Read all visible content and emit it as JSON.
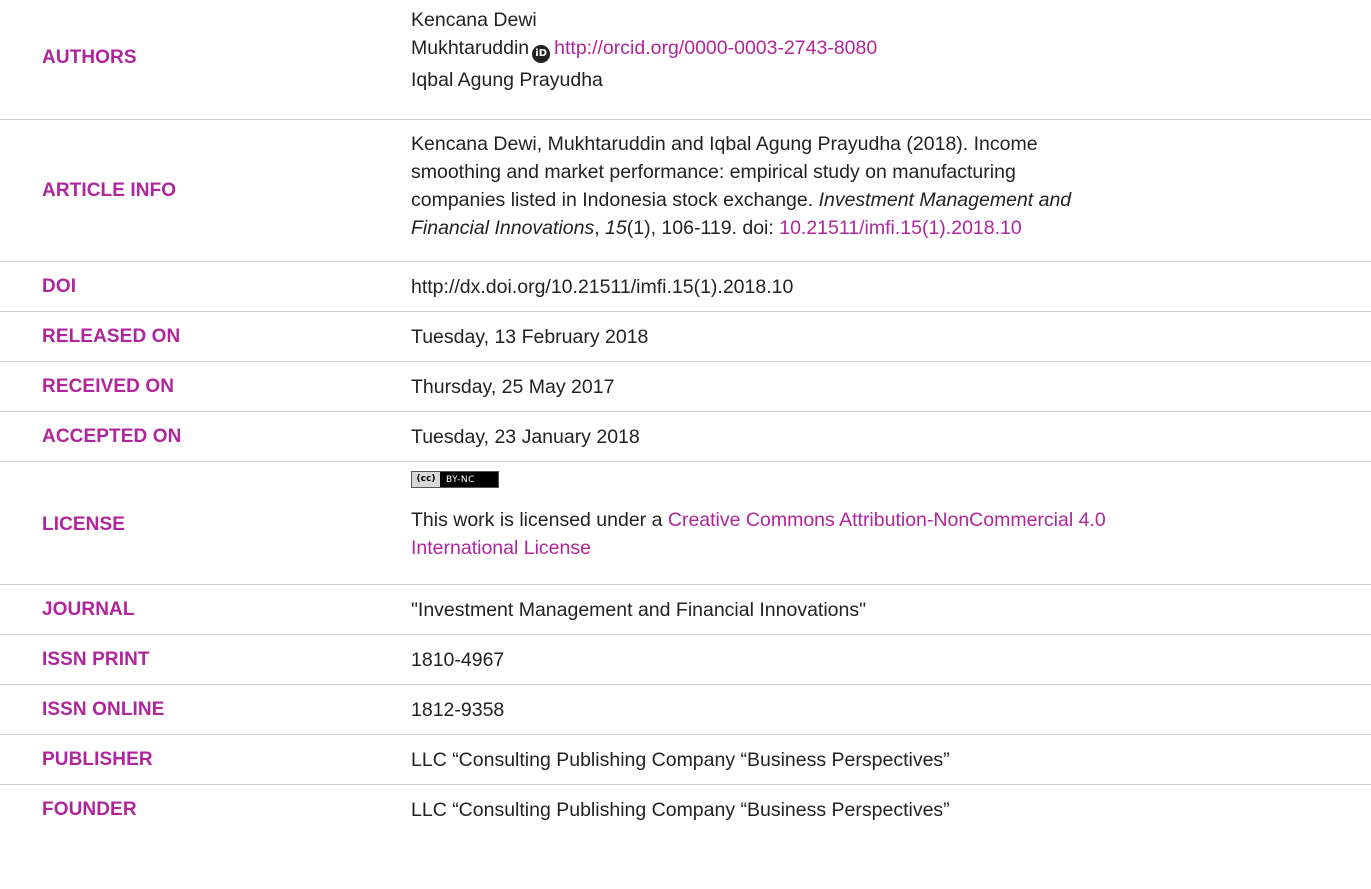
{
  "authors": {
    "label": "AUTHORS",
    "names": [
      "Kencana Dewi",
      "Mukhtaruddin",
      "Iqbal Agung Prayudha"
    ],
    "orcid_icon": "orcid-icon",
    "orcid_url": "http://orcid.org/0000-0003-2743-8080"
  },
  "article_info": {
    "label": "ARTICLE INFO",
    "line1": "Kencana Dewi, Mukhtaruddin and Iqbal Agung Prayudha (2018). Income",
    "line2": "smoothing and market performance: empirical study on manufacturing",
    "line3_plain": "companies listed in Indonesia stock exchange. ",
    "journal_italic_a": "Investment Management and",
    "journal_italic_b": "Financial Innovations",
    "comma": ", ",
    "volume": "15",
    "issue_pages": "(1), 106-119. doi: ",
    "doi_link": "10.21511/imfi.15(1).2018.10"
  },
  "doi": {
    "label": "DOI",
    "value": "http://dx.doi.org/10.21511/imfi.15(1).2018.10"
  },
  "released": {
    "label": "RELEASED ON",
    "value": "Tuesday, 13 February 2018"
  },
  "received": {
    "label": "RECEIVED ON",
    "value": "Thursday, 25 May 2017"
  },
  "accepted": {
    "label": "ACCEPTED ON",
    "value": "Tuesday, 23 January 2018"
  },
  "license": {
    "label": "LICENSE",
    "badge_left": "(cc)",
    "badge_right": "BY-NC",
    "text": "This work is licensed under a ",
    "link_line1": "Creative Commons Attribution-NonCommercial 4.0",
    "link_line2": "International License"
  },
  "journal": {
    "label": "JOURNAL",
    "value": "\"Investment Management and Financial Innovations\""
  },
  "issn_print": {
    "label": "ISSN PRINT",
    "value": "1810-4967"
  },
  "issn_online": {
    "label": "ISSN ONLINE",
    "value": "1812-9358"
  },
  "publisher": {
    "label": "PUBLISHER",
    "value": "LLC “Consulting Publishing Company “Business Perspectives”"
  },
  "founder": {
    "label": "FOUNDER",
    "value": "LLC “Consulting Publishing Company “Business Perspectives”"
  },
  "colors": {
    "accent": "#b0259c",
    "divider": "#cfcfcf",
    "text": "#222222"
  }
}
